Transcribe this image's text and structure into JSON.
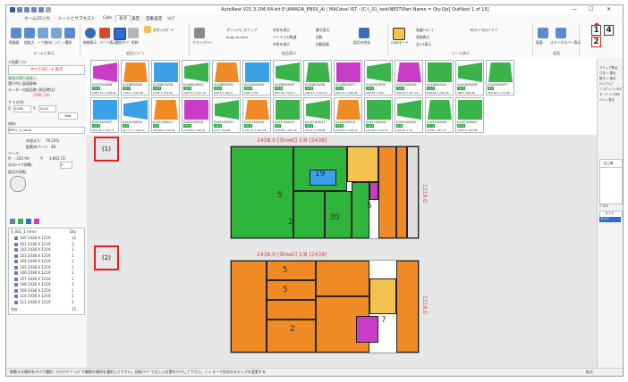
{
  "window": {
    "title": "AutoNest V21.3.206 64-bit    E:\\AMADA_ENSS_AI    / MACdvel IST - [C:\\_01_test\\NEST\\Part Name = Qty.Ojs] OutNest 1 of 15]",
    "controls": [
      "—",
      "☐",
      "✕"
    ]
  },
  "tabs": [
    "ホーム/ロジカ",
    "シートとサブネスト",
    "Cale",
    "表示",
    "設定",
    "自動設定",
    "ﾍﾙﾌﾟ"
  ],
  "active_tab": "表示",
  "ribbon": {
    "groups": [
      {
        "label": "ズームと表示",
        "buttons": [
          "再描画",
          "倍拡大",
          "一つ前のﾋﾞｭｰ",
          "ﾋﾞｭｰ選択",
          "全体表示"
        ]
      },
      {
        "label": "部品ｳｨﾝﾄﾞｳ",
        "buttons": [
          "新規表示",
          "パーツ表示",
          "選択ｸﾘｰﾄﾞ",
          "削除",
          "文字入力ﾎﾞｰﾄﾞ"
        ]
      },
      {
        "label": "部品表示",
        "buttons": [
          "クランプバー",
          "グリッドにスナップ",
          "Snap to Grid",
          "外形を表示",
          "シートとの軌道",
          "内形を表示",
          "番号表示",
          "回転",
          "自動回転",
          "部品を除去"
        ]
      },
      {
        "label": "ツール表示",
        "buttons": [
          "CAMモード",
          "高速ﾂｰﾙﾊﾟｽ",
          "収納表示",
          "全ﾂｰﾙ表示",
          "ﾏﾙﾁｶｰﾌﾞのｽﾃﾌﾞﾙｰﾌﾟ"
        ]
      },
      {
        "label": "画面",
        "buttons": [
          "画面",
          "ステータスバー表示"
        ]
      }
    ]
  },
  "left_panel": {
    "header": "<残実ﾌﾞﾙ>",
    "all_parts_button": "すべてのﾎﾞｰﾀﾞ表示",
    "checkbox1": "最適化実行後表示",
    "checkbox2": "実行中に画面更新",
    "order_label": "オーダー内部品数 (前回時比):",
    "order_value": "(不明: 23)",
    "sheet_size_label": "サイズ(X)",
    "x_label": "X:",
    "x_value": "2438",
    "y_label": "Y:",
    "y_value": "1219",
    "unit": "Mat",
    "material_label": "材料:",
    "material_value": "BPCL_1 (mm)",
    "yield_label": "歩留まり:",
    "yield_value": "79.22%",
    "parts_label": "配置済パーツ:",
    "parts_value": "48",
    "tool_label": "ツール:",
    "x2_label": "X:",
    "x2_value": "-242.94",
    "y2_label": "Y:",
    "y2_value": "3,663.72",
    "grid_label": "次のｼｰﾄで移動:",
    "grid_value": "0",
    "order_list_header": "部品の回転:",
    "tree_title": "S_001_1 (mm)",
    "tree_qty_header": "Qty",
    "tree_rows": [
      {
        "name": "100 2438 X 1219",
        "qty": "12"
      },
      {
        "name": "101 2438 X 1219",
        "qty": "1"
      },
      {
        "name": "102 2438 X 1219",
        "qty": "1"
      },
      {
        "name": "103 2438 X 1219",
        "qty": "1"
      },
      {
        "name": "104 2438 X 1219",
        "qty": "1"
      },
      {
        "name": "105 2438 X 1219",
        "qty": "1"
      },
      {
        "name": "106 2438 X 1219",
        "qty": "1"
      },
      {
        "name": "107 2438 X 1219",
        "qty": "1"
      },
      {
        "name": "108 2438 X 1219",
        "qty": "1"
      },
      {
        "name": "109 2438 X 1219",
        "qty": "1"
      },
      {
        "name": "110 2438 X 1219",
        "qty": "1"
      },
      {
        "name": "111 2438 X 1219",
        "qty": "1"
      }
    ],
    "tree_total_label": "合計",
    "tree_total_value": "15"
  },
  "thumbnails": [
    {
      "name": "01423204006",
      "qty": "10.0",
      "dims": "1487.14 x 538.06",
      "color": "#c83cc8"
    },
    {
      "name": "01428020040",
      "qty": "16.0",
      "dims": "743.5 x 310.08",
      "color": "#f08a24"
    },
    {
      "name": "01428020036",
      "qty": "14.0",
      "dims": "1042 x 310.06",
      "color": "#3aa0e8"
    },
    {
      "name": "01428020041",
      "qty": "10.0",
      "dims": "1053.9 x 423.78",
      "color": "#3ab44a"
    },
    {
      "name": "01428020051",
      "qty": "24.0",
      "dims": "503.5 x 782.9",
      "color": "#f08a24"
    },
    {
      "name": "01428200020",
      "qty": "20.0",
      "dims": "446 x 518",
      "color": "#3aa0e8"
    },
    {
      "name": "01428020043",
      "qty": "14.0",
      "dims": "587.34 x 532.5",
      "color": "#3ab44a"
    },
    {
      "name": "01428020048",
      "qty": "14.0",
      "dims": "408.14 x 230.14",
      "color": "#3ab44a"
    },
    {
      "name": "01428020051",
      "qty": "12.0",
      "dims": "602.12 x 296.45",
      "color": "#c83cc8"
    },
    {
      "name": "01422020010",
      "qty": "14.2",
      "dims": "302.85 x 283",
      "color": "#3ab44a"
    },
    {
      "name": "01431500044",
      "qty": "14.0",
      "dims": "364.32 x 207.03",
      "color": "#c83cc8"
    },
    {
      "name": "01428020042",
      "qty": "14.0",
      "dims": "609.26 x 296.45",
      "color": "#3ab44a"
    },
    {
      "name": "01422020006",
      "qty": "10.0",
      "dims": "388 x 166.38",
      "color": "#3ab44a"
    },
    {
      "name": "01422020007",
      "qty": "8.0",
      "dims": "365.86 x 172.88",
      "color": "#3ab44a"
    },
    {
      "name": "01423102007",
      "qty": "14.4",
      "dims": "364.34 x 370.71",
      "color": "#3aa0e8"
    },
    {
      "name": "01431100010",
      "qty": "9.0",
      "dims": "917.17 x 108.27",
      "color": "#3aa0e8"
    },
    {
      "name": "01431100011",
      "qty": "9.0",
      "dims": "264.88 x 216.81",
      "color": "#f08a24"
    },
    {
      "name": "01431100019",
      "qty": "10.0",
      "dims": "278.89 x 196.01",
      "color": "#c83cc8"
    },
    {
      "name": "01431100021",
      "qty": "10.0",
      "dims": "273 x 64.88",
      "color": "#3ab44a"
    },
    {
      "name": "01431100012",
      "qty": "10.0",
      "dims": "591.37 x 103.28",
      "color": "#f08a24"
    },
    {
      "name": "01431100013",
      "qty": "8.0",
      "dims": "539.98 x 187.76",
      "color": "#3ab44a"
    },
    {
      "name": "01431100017",
      "qty": "10.0",
      "dims": "354.4 x 148.85",
      "color": "#3ab44a"
    },
    {
      "name": "01431100014",
      "qty": "10.0",
      "dims": "216.45 x 138.12",
      "color": "#f08a24"
    },
    {
      "name": "01431100026",
      "qty": "14.0",
      "dims": "540.69 x 114.74",
      "color": "#3ab44a"
    },
    {
      "name": "01431100002",
      "qty": "8.0",
      "dims": "209.22 x 44",
      "color": "#3ab44a"
    },
    {
      "name": "01431100009",
      "qty": "12.0",
      "dims": "1106 x 187.37",
      "color": "#3ab44a"
    },
    {
      "name": "01431100003",
      "qty": "24.0",
      "dims": "790.8 x 150.85",
      "color": "#3ab44a"
    }
  ],
  "right_panel": {
    "top_buttons": [
      "1",
      "4",
      "2"
    ],
    "labels": [
      "ステップ表示",
      "寸法 = 表示",
      "数付 = 表示",
      "ｸﾘｯﾌﾟｳﾘｯﾌﾟ",
      "ﾊﾞｯﾁｳﾞｨﾝ = OFF",
      "モード = CMR",
      "ﾂｰﾙ = 表示"
    ],
    "tool_header": "加工順",
    "mid_label": "T 100",
    "list_item1": "B 0.0",
    "list_item2": "B 0.2"
  },
  "sheets": [
    {
      "label": "(1)",
      "dim_top": "2438.0",
      "dim_side": "1219.0",
      "dim_top_text": "2438.0 [Sheet] 1/8 [2438]"
    },
    {
      "label": "(2)",
      "dim_top": "2438.0",
      "dim_side": "1219.0",
      "dim_top_text": "2438.0 [Sheet] 1/8 [2438]"
    }
  ],
  "status_bar": {
    "text": "移動する場所をｸﾘｯｸで選択 , ｸﾘｯｸｱﾝﾄﾞﾄﾞﾗｯｸﾞで複数の場所を選択して下さい。回転ｸﾘｰﾄﾞで正しい位置をｸﾘｯｸして下さい。 / ↓ キーで別次のステップを変更する",
    "zoom": "拡大"
  },
  "annotations": [
    {
      "label": "(1)"
    },
    {
      "label": "(2)"
    },
    {
      "label": "2"
    }
  ]
}
